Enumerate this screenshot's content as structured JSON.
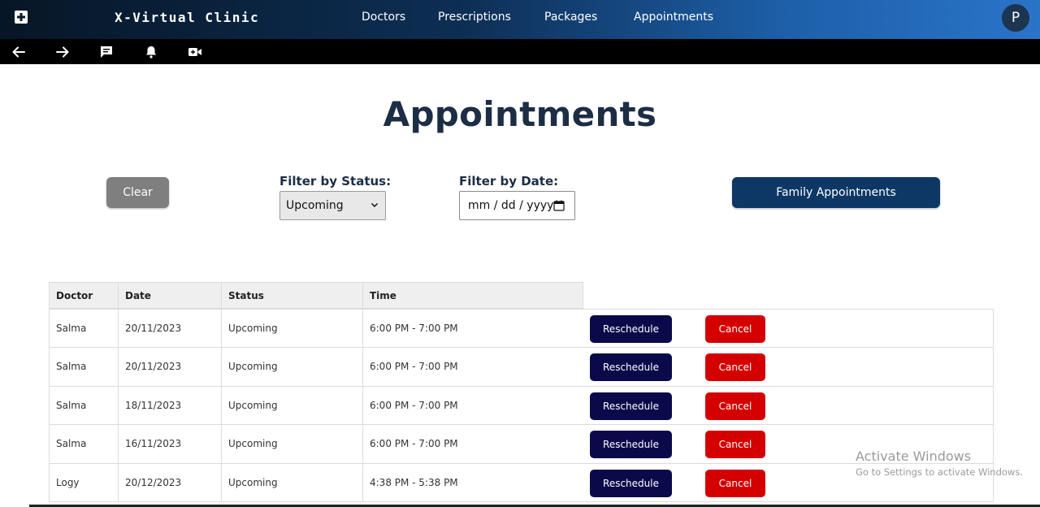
{
  "app": {
    "brand": "X-Virtual Clinic",
    "avatar_initial": "P"
  },
  "nav": {
    "doctors": "Doctors",
    "prescriptions": "Prescriptions",
    "packages": "Packages",
    "appointments": "Appointments"
  },
  "page": {
    "title": "Appointments"
  },
  "filters": {
    "clear_label": "Clear",
    "status_label": "Filter by Status:",
    "status_value": "Upcoming",
    "date_label": "Filter by Date:",
    "date_placeholder": "mm / dd / yyyy",
    "family_label": "Family Appointments"
  },
  "table": {
    "headers": [
      "Doctor",
      "Date",
      "Status",
      "Time"
    ],
    "reschedule_label": "Reschedule",
    "cancel_label": "Cancel",
    "rows": [
      {
        "doctor": "Salma",
        "date": "20/11/2023",
        "status": "Upcoming",
        "time": "6:00 PM - 7:00 PM"
      },
      {
        "doctor": "Salma",
        "date": "20/11/2023",
        "status": "Upcoming",
        "time": "6:00 PM - 7:00 PM"
      },
      {
        "doctor": "Salma",
        "date": "18/11/2023",
        "status": "Upcoming",
        "time": "6:00 PM - 7:00 PM"
      },
      {
        "doctor": "Salma",
        "date": "16/11/2023",
        "status": "Upcoming",
        "time": "6:00 PM - 7:00 PM"
      },
      {
        "doctor": "Logy",
        "date": "20/12/2023",
        "status": "Upcoming",
        "time": "4:38 PM - 5:38 PM"
      }
    ]
  },
  "watermark": {
    "title": "Activate Windows",
    "subtitle": "Go to Settings to activate Windows."
  },
  "colors": {
    "primary": "#0d3866",
    "reschedule": "#0a0a4a",
    "cancel": "#d40000",
    "title": "#1c2d45"
  }
}
